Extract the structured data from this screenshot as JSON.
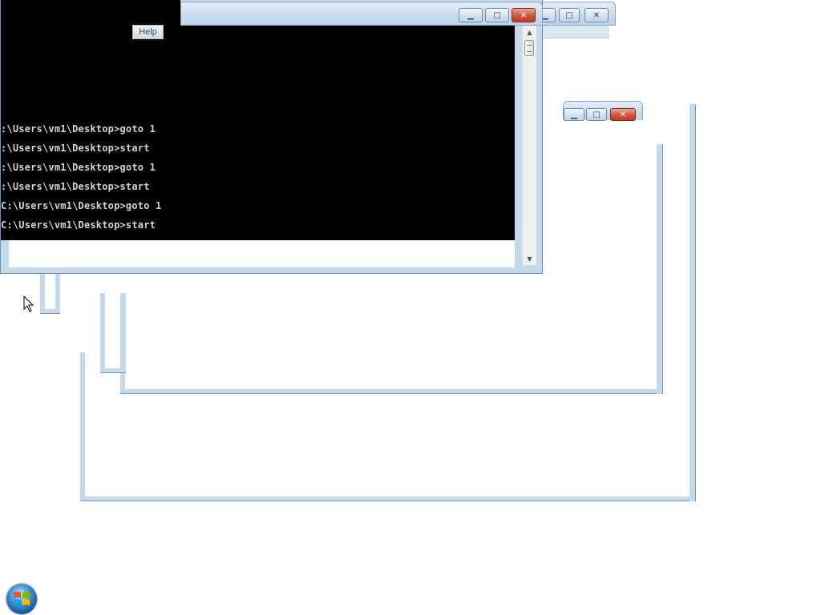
{
  "console": {
    "help_label": "Help",
    "lines": [
      ":\\Users\\vm1\\Desktop>goto 1",
      ":\\Users\\vm1\\Desktop>start",
      ":\\Users\\vm1\\Desktop>goto 1",
      ":\\Users\\vm1\\Desktop>start",
      "C:\\Users\\vm1\\Desktop>goto 1",
      "C:\\Users\\vm1\\Desktop>start"
    ],
    "minimize_glyph": "▁",
    "maximize_glyph": "□",
    "close_glyph": "✕"
  },
  "background_windows": {
    "minimize_glyph": "▁",
    "maximize_glyph": "□",
    "close_glyph": "✕"
  },
  "taskbar": {
    "start_icon": "windows-start-orb"
  },
  "colors": {
    "frame": "#c6d9ea",
    "console_bg": "#000000",
    "console_text": "#d4d4d4",
    "close_button": "#c23b25"
  }
}
